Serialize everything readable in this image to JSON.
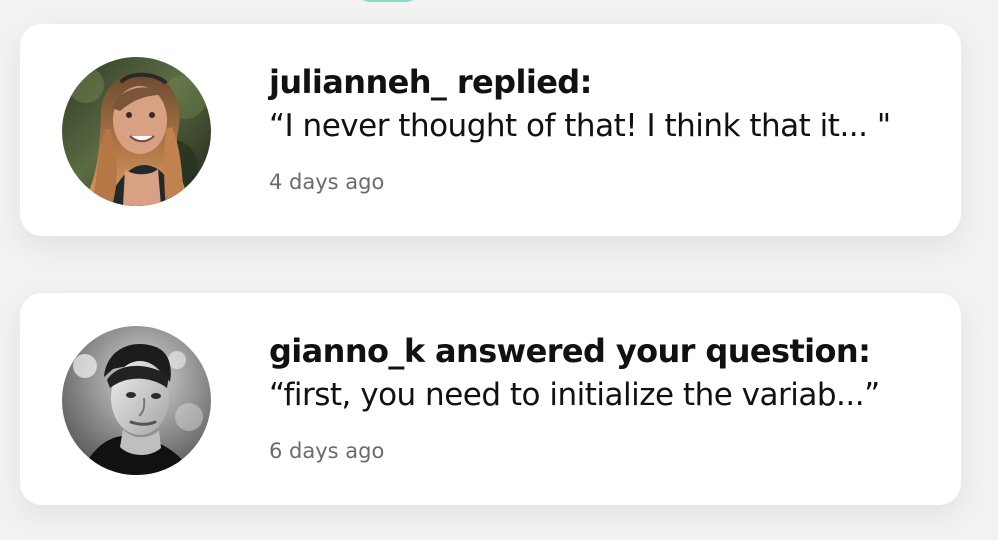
{
  "notifications": [
    {
      "title": "julianneh_ replied:",
      "message": "“I never thought of that! I think that it... \"",
      "time": "4 days ago",
      "avatar_icon": "woman-photo-avatar"
    },
    {
      "title": "gianno_k answered your question:",
      "message": "“first, you need to initialize the variab...”",
      "time": "6 days ago",
      "avatar_icon": "man-photo-avatar"
    }
  ],
  "colors": {
    "background": "#f2f2f2",
    "card": "#ffffff",
    "text": "#111111",
    "muted_text": "#6b6b6b",
    "accent": "#7ed6c7"
  }
}
